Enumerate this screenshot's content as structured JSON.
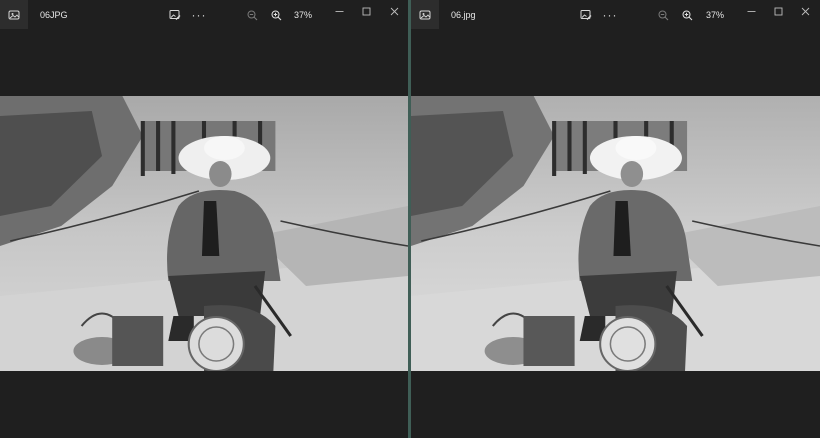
{
  "left": {
    "title": "06JPG",
    "zoom": "37%",
    "icons": [
      "photos-app-icon",
      "edit-image-icon",
      "more-icon",
      "zoom-out-icon",
      "zoom-in-icon",
      "minimize-icon",
      "maximize-icon",
      "close-icon"
    ]
  },
  "right": {
    "title": "06.jpg",
    "zoom": "37%",
    "icons": [
      "photos-app-icon",
      "edit-image-icon",
      "more-icon",
      "zoom-out-icon",
      "zoom-in-icon",
      "minimize-icon",
      "maximize-icon",
      "close-icon"
    ]
  },
  "colors": {
    "background": "#1f1f1f",
    "divider": "#3f5e56"
  }
}
